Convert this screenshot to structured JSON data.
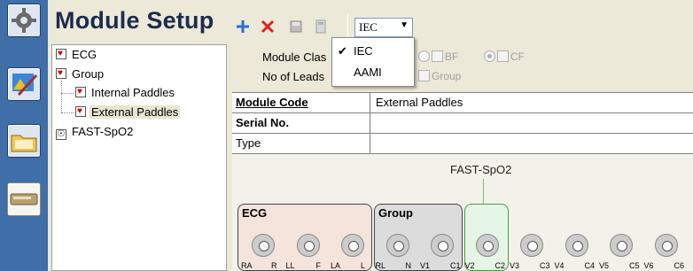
{
  "header": {
    "title": "Module Setup"
  },
  "toolbar": {
    "add_icon": "plus-icon",
    "delete_icon": "x-icon",
    "standard_value": "IEC"
  },
  "standard_menu": {
    "items": [
      {
        "label": "IEC",
        "checked": true
      },
      {
        "label": "AAMI",
        "checked": false
      }
    ]
  },
  "tree": {
    "items": [
      {
        "label": "ECG",
        "icon": "heart-icon"
      },
      {
        "label": "Group",
        "icon": "heart-icon"
      },
      {
        "label": "Internal Paddles",
        "icon": "heart-icon"
      },
      {
        "label": "External Paddles",
        "icon": "heart-icon",
        "selected": true
      },
      {
        "label": "FAST-SpO2",
        "icon": "person-icon"
      }
    ]
  },
  "form": {
    "module_class_label": "Module Clas",
    "leads_label": "No of Leads",
    "class_options": [
      "BF",
      "CF"
    ],
    "group_label": "Group"
  },
  "grid": {
    "rows": [
      {
        "key": "Module Code",
        "value": "External Paddles"
      },
      {
        "key": "Serial No.",
        "value": ""
      },
      {
        "key": "Type",
        "value": ""
      }
    ]
  },
  "diagram": {
    "module_label": "FAST-SpO2",
    "groups": [
      "ECG",
      "Group"
    ],
    "connector_labels": [
      "RA",
      "R",
      "LL",
      "F",
      "LA",
      "L",
      "RL",
      "N",
      "V1",
      "C1",
      "V2",
      "C2",
      "V3",
      "C3",
      "V4",
      "C4",
      "V5",
      "C5",
      "V6",
      "C6"
    ]
  },
  "colors": {
    "sidebar": "#3f6ea8",
    "title": "#1c2c4e",
    "add": "#2b6fd6",
    "delete": "#e0201a"
  }
}
